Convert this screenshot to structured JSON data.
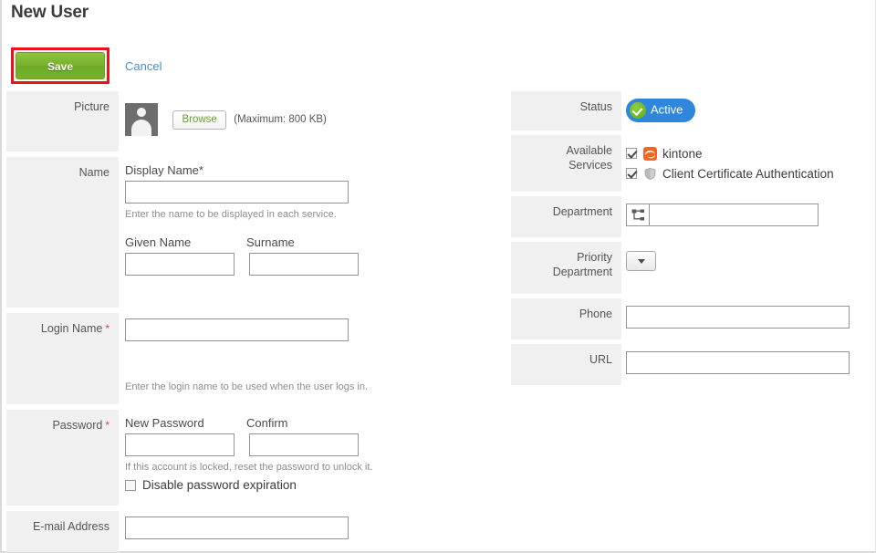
{
  "page": {
    "title": "New User"
  },
  "toolbar": {
    "save_label": "Save",
    "cancel_label": "Cancel",
    "highlight_color": "#e8131b",
    "save_color": "#79b02f"
  },
  "left_fields": {
    "picture": {
      "label": "Picture",
      "browse_label": "Browse",
      "max_note": "(Maximum: 800 KB)"
    },
    "name": {
      "label": "Name",
      "display_name_label": "Display Name",
      "display_name_required": "*",
      "display_name_value": "",
      "hint": "Enter the name to be displayed in each service.",
      "given_name_label": "Given Name",
      "given_name_value": "",
      "surname_label": "Surname",
      "surname_value": ""
    },
    "login_name": {
      "label": "Login Name",
      "required": "*",
      "value": "",
      "hint": "Enter the login name to be used when the user logs in."
    },
    "password": {
      "label": "Password",
      "required": "*",
      "new_password_label": "New Password",
      "new_password_value": "",
      "confirm_label": "Confirm",
      "confirm_value": "",
      "hint": "If this account is locked, reset the password to unlock it.",
      "disable_expiration_label": "Disable password expiration",
      "disable_expiration_checked": false
    },
    "email": {
      "label": "E-mail Address",
      "value": ""
    }
  },
  "right_fields": {
    "status": {
      "label": "Status",
      "value": "Active",
      "badge_color": "#2f86dd",
      "check_color": "#5aa81c"
    },
    "available_services": {
      "label_line1": "Available",
      "label_line2": "Services",
      "items": [
        {
          "name": "kintone",
          "checked": true,
          "icon": "kintone-icon",
          "icon_color": "#f26522"
        },
        {
          "name": "Client Certificate Authentication",
          "checked": true,
          "icon": "shield-icon",
          "icon_color": "#b5b5b5"
        }
      ]
    },
    "department": {
      "label": "Department",
      "value": "",
      "icon": "org-tree-icon"
    },
    "priority_department": {
      "label_line1": "Priority",
      "label_line2": "Department",
      "selected": ""
    },
    "phone": {
      "label": "Phone",
      "value": ""
    },
    "url": {
      "label": "URL",
      "value": ""
    }
  }
}
